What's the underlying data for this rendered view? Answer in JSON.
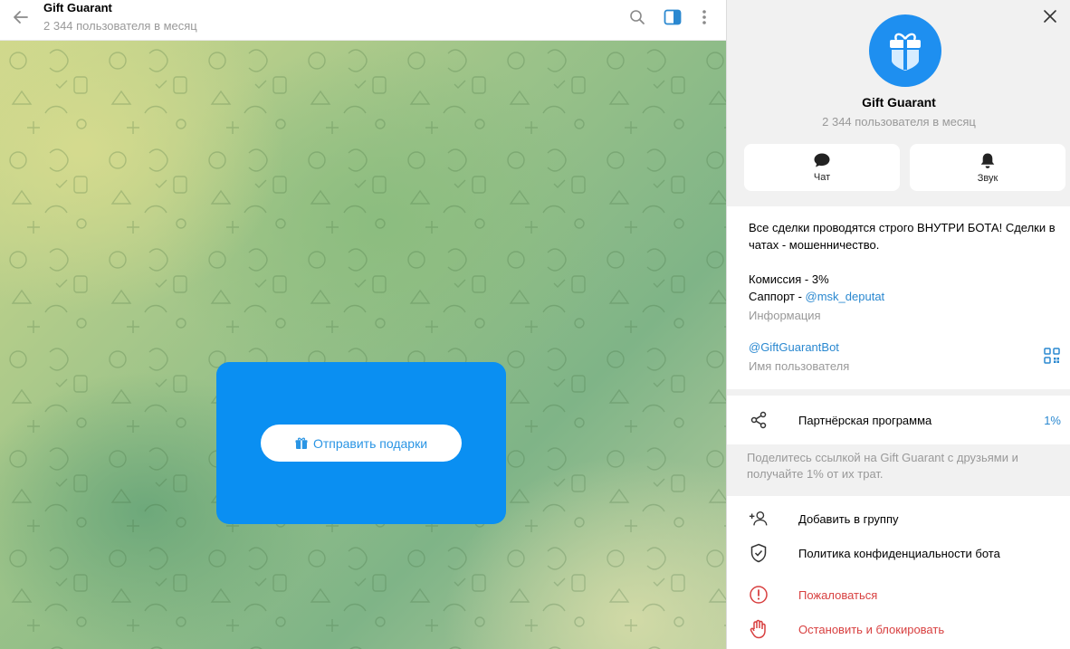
{
  "header": {
    "title": "Gift Guarant",
    "subtitle": "2 344 пользователя в месяц"
  },
  "bot_card": {
    "button_label": "Отправить подарки",
    "color": "#0A8FF2"
  },
  "panel": {
    "name": "Gift Guarant",
    "subtitle": "2 344 пользователя в месяц",
    "actions": [
      {
        "label": "Чат",
        "icon": "chat-icon"
      },
      {
        "label": "Звук",
        "icon": "bell-icon"
      }
    ],
    "description": {
      "line1": "Все сделки проводятся строго ВНУТРИ БОТА! Сделки в",
      "line2": "чатах - мошенничество.",
      "commission": "Комиссия - 3%",
      "support_prefix": "Саппорт - ",
      "support_link": "@msk_deputat",
      "caption": "Информация"
    },
    "username": {
      "value": "@GiftGuarantBot",
      "caption": "Имя пользователя"
    },
    "affiliate": {
      "label": "Партнёрская программа",
      "value": "1%",
      "note_line1": "Поделитесь ссылкой на Gift Guarant с друзьями и",
      "note_line2": "получайте 1% от их трат."
    },
    "menu": [
      {
        "label": "Добавить в группу",
        "icon": "add-user-icon",
        "danger": false
      },
      {
        "label": "Политика конфиденциальности бота",
        "icon": "shield-icon",
        "danger": false
      },
      {
        "label": "Пожаловаться",
        "icon": "report-icon",
        "danger": true
      },
      {
        "label": "Остановить и блокировать",
        "icon": "hand-stop-icon",
        "danger": true
      }
    ]
  },
  "colors": {
    "accent": "#2A88D0",
    "danger": "#D84040",
    "avatar": "#1E8FF0"
  }
}
